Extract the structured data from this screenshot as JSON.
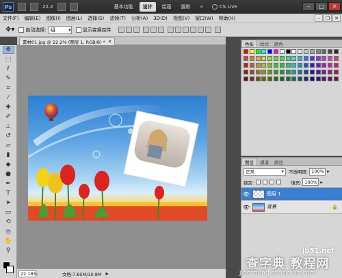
{
  "app": {
    "logo": "Ps",
    "zoom_level": "22.2"
  },
  "workspace": {
    "items": [
      "基本功能",
      "设计",
      "绘画",
      "摄影"
    ],
    "active_index": 1,
    "cslive_label": "CS Live"
  },
  "menu": [
    "文件(F)",
    "编辑(E)",
    "图像(I)",
    "图层(L)",
    "选择(S)",
    "滤镜(T)",
    "分析(A)",
    "3D(D)",
    "视图(V)",
    "窗口(W)",
    "帮助(H)"
  ],
  "options": {
    "auto_select_label": "自动选择:",
    "auto_select_value": "组",
    "show_transform_label": "显示变换控件"
  },
  "document": {
    "tab_title": "素材01.jpg @ 22.2% (图层 1, RGB/8) *",
    "zoom": "22.18%",
    "doc_size": "文档:7.85M/10.8M"
  },
  "swatches_panel": {
    "tabs": [
      "色板",
      "样式",
      "颜色"
    ],
    "active_index": 0
  },
  "layers_panel": {
    "tabs": [
      "图层",
      "通道",
      "路径"
    ],
    "active_index": 0,
    "blend_mode": "正常",
    "opacity_label": "不透明度:",
    "opacity_value": "100%",
    "lock_label": "锁定:",
    "fill_label": "填充:",
    "fill_value": "100%",
    "layers": [
      {
        "name": "图层 1",
        "selected": true
      },
      {
        "name": "背景",
        "selected": false
      }
    ]
  },
  "watermark": {
    "line1": "jb51.net",
    "line2": "查字典 教程网",
    "line3": "jiaocheng.chazidian.com"
  },
  "colors": {
    "accent": "#3c7fd1",
    "selection_blue": "#9db7d6",
    "panel_bg": "#d6d6d6"
  }
}
